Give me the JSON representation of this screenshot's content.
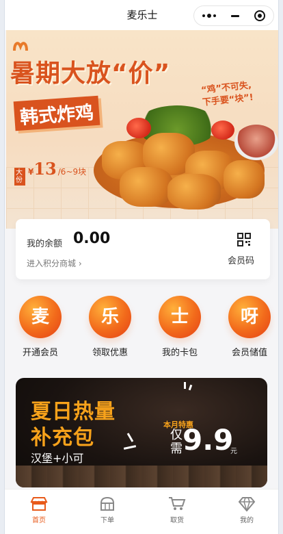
{
  "app": {
    "title": "麦乐士"
  },
  "banner": {
    "headline": "暑期大放“价”",
    "subtitle": "韩式炸鸡",
    "slogan_line1": "“鸡”不可失,",
    "slogan_line2": "下手要“块”!",
    "price_label": "大份",
    "price_currency": "¥",
    "price_value": "13",
    "price_unit": "/6~9块"
  },
  "balance": {
    "label": "我的余额",
    "value": "0.00",
    "link": "进入积分商城",
    "member_code_label": "会员码",
    "member_code_icon": "qr-code-icon"
  },
  "quick_entries": [
    {
      "char": "麦",
      "label": "开通会员"
    },
    {
      "char": "乐",
      "label": "领取优惠"
    },
    {
      "char": "士",
      "label": "我的卡包"
    },
    {
      "char": "呀",
      "label": "会员储值"
    }
  ],
  "promo": {
    "title1": "夏日热量",
    "title2": "补充包",
    "desc": "汉堡+小可",
    "tag": "本月特惠",
    "only": "仅需",
    "price": "9.9",
    "unit": "元"
  },
  "tabs": [
    {
      "label": "首页",
      "icon": "store-icon",
      "active": true
    },
    {
      "label": "下单",
      "icon": "cake-icon",
      "active": false
    },
    {
      "label": "取货",
      "icon": "cart-icon",
      "active": false
    },
    {
      "label": "我的",
      "icon": "diamond-icon",
      "active": false
    }
  ],
  "colors": {
    "accent": "#e85a1a",
    "promo_gold": "#f7a21b"
  }
}
